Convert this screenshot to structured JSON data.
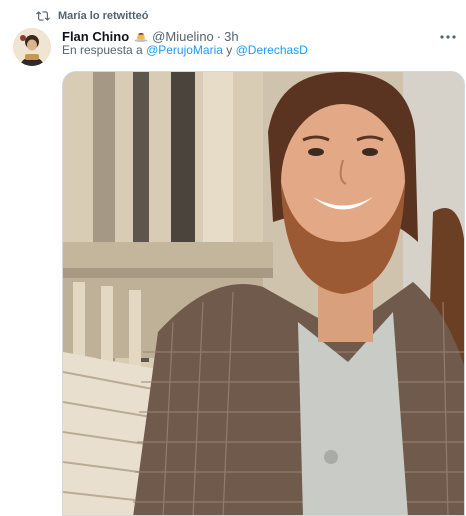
{
  "retweet": {
    "label": "María lo retwitteó",
    "icon": "retweet-icon"
  },
  "author": {
    "display_name": "Flan Chino",
    "emoji": "flan-icon",
    "handle": "@Miuelino",
    "separator": "·",
    "time": "3h"
  },
  "reply": {
    "prefix": "En respuesta a",
    "mention_1": "@PerujoMaria",
    "conjunction": "y",
    "mention_2": "@DerechasD"
  },
  "colors": {
    "text_primary": "#0f1419",
    "text_secondary": "#536471",
    "link": "#1d9bf0",
    "border": "#cfd9de"
  }
}
